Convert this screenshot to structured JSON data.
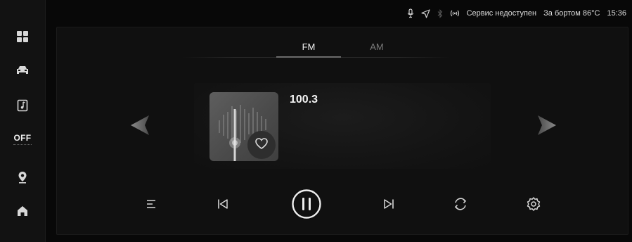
{
  "sidebar": {
    "items": [
      {
        "name": "apps"
      },
      {
        "name": "car"
      },
      {
        "name": "music-note"
      },
      {
        "name": "off-toggle",
        "label": "OFF"
      },
      {
        "name": "location-pin"
      },
      {
        "name": "home"
      }
    ]
  },
  "status": {
    "service_text": "Сервис недоступен",
    "outside_temp": "За бортом 86°C",
    "time": "15:36",
    "icons": [
      "microphone-icon",
      "navigation-icon",
      "bluetooth-icon",
      "signal-icon"
    ]
  },
  "tabs": [
    {
      "label": "FM",
      "active": true
    },
    {
      "label": "AM",
      "active": false
    }
  ],
  "station": {
    "frequency": "100.3"
  },
  "controls": [
    "playlist",
    "previous",
    "pause",
    "next",
    "repeat",
    "settings"
  ],
  "colors": {
    "background": "#080808",
    "panel": "#101010",
    "text": "#e6e6e6",
    "inactive_text": "#7a7a7a"
  }
}
